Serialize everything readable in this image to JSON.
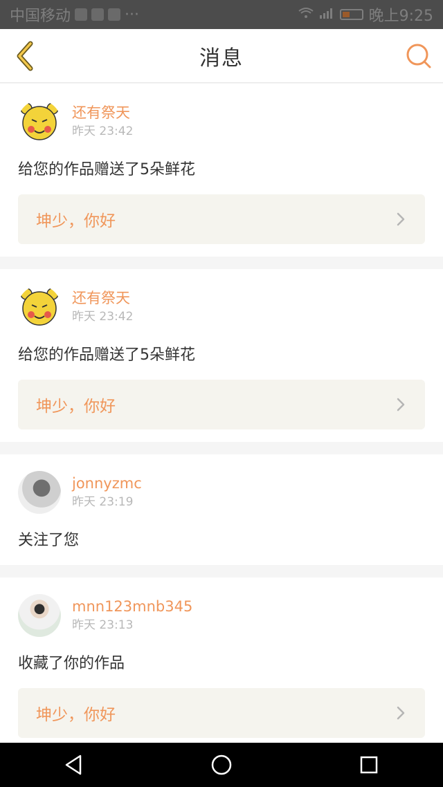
{
  "status_bar": {
    "carrier": "中国移动",
    "time": "晚上9:25"
  },
  "header": {
    "title": "消息",
    "back_icon": "chevron-left-icon",
    "search_icon": "search-icon",
    "accent": "#f0965a"
  },
  "notifications": [
    {
      "user": "还有祭天",
      "time": "昨天 23:42",
      "message": "给您的作品赠送了5朵鲜花",
      "quote": "坤少，你好",
      "avatar_icon": "bear-avatar"
    },
    {
      "user": "还有祭天",
      "time": "昨天 23:42",
      "message": "给您的作品赠送了5朵鲜花",
      "quote": "坤少，你好",
      "avatar_icon": "bear-avatar"
    },
    {
      "user": "jonnyzmc",
      "time": "昨天 23:19",
      "message": "关注了您",
      "avatar_icon": "gray-avatar"
    },
    {
      "user": "mnn123mnb345",
      "time": "昨天 23:13",
      "message": "收藏了你的作品",
      "quote": "坤少，你好",
      "avatar_icon": "photo-avatar"
    }
  ],
  "system_nav": {
    "back_icon": "triangle-back-icon",
    "home_icon": "circle-home-icon",
    "recent_icon": "square-recent-icon"
  }
}
